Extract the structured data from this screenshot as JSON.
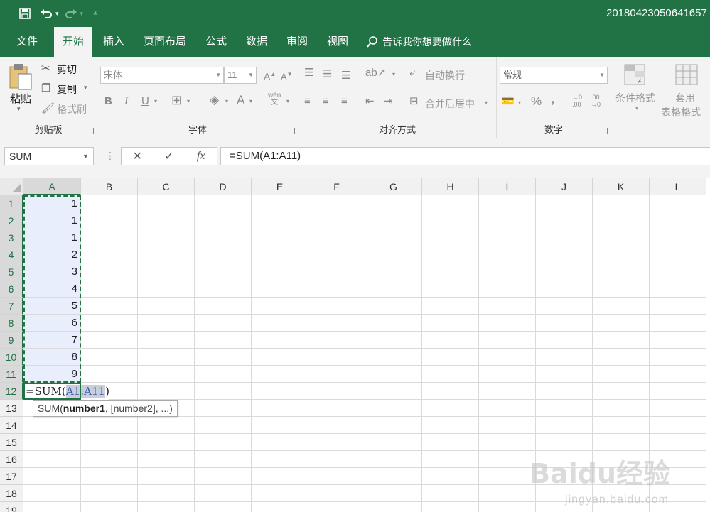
{
  "title_bar": {
    "filename": "20180423050641657",
    "accent_color": "#217346"
  },
  "quick_access": [
    "save-icon",
    "undo-icon",
    "redo-icon",
    "customize-icon"
  ],
  "tabs": [
    {
      "label": "文件",
      "active": false
    },
    {
      "label": "开始",
      "active": true
    },
    {
      "label": "插入",
      "active": false
    },
    {
      "label": "页面布局",
      "active": false
    },
    {
      "label": "公式",
      "active": false
    },
    {
      "label": "数据",
      "active": false
    },
    {
      "label": "审阅",
      "active": false
    },
    {
      "label": "视图",
      "active": false
    }
  ],
  "tell_me": "告诉我你想要做什么",
  "ribbon": {
    "clipboard": {
      "label": "剪贴板",
      "paste": "粘贴",
      "cut": "剪切",
      "copy": "复制",
      "format_painter": "格式刷"
    },
    "font": {
      "label": "字体",
      "font_name": "宋体",
      "font_size": "11",
      "bold": "B",
      "italic": "I",
      "underline": "U",
      "font_color": "A",
      "wen": "wén"
    },
    "alignment": {
      "label": "对齐方式",
      "wrap_text": "自动换行",
      "merge_center": "合并后居中"
    },
    "number": {
      "label": "数字",
      "format": "常规",
      "percent": "%",
      "comma": ","
    },
    "styles": {
      "conditional_format": "条件格式",
      "table_format_1": "套用",
      "table_format_2": "表格格式"
    }
  },
  "formula_bar": {
    "name_box": "SUM",
    "formula": "=SUM(A1:A11)",
    "fx": "fx"
  },
  "columns": [
    "A",
    "B",
    "C",
    "D",
    "E",
    "F",
    "G",
    "H",
    "I",
    "J",
    "K",
    "L"
  ],
  "rows": [
    "1",
    "2",
    "3",
    "4",
    "5",
    "6",
    "7",
    "8",
    "9",
    "10",
    "11",
    "12",
    "13",
    "14",
    "15",
    "16",
    "17",
    "18",
    "19"
  ],
  "column_a_values": [
    "1",
    "1",
    "1",
    "2",
    "3",
    "4",
    "5",
    "6",
    "7",
    "8",
    "9"
  ],
  "editing_cell": {
    "prefix": "=SUM(",
    "ref": "A1:A11",
    "suffix": ")"
  },
  "tooltip": {
    "func": "SUM(",
    "arg1": "number1",
    "rest": ", [number2], ...)"
  },
  "watermark": {
    "main": "Baidu经验",
    "sub": "jingyan.baidu.com"
  }
}
